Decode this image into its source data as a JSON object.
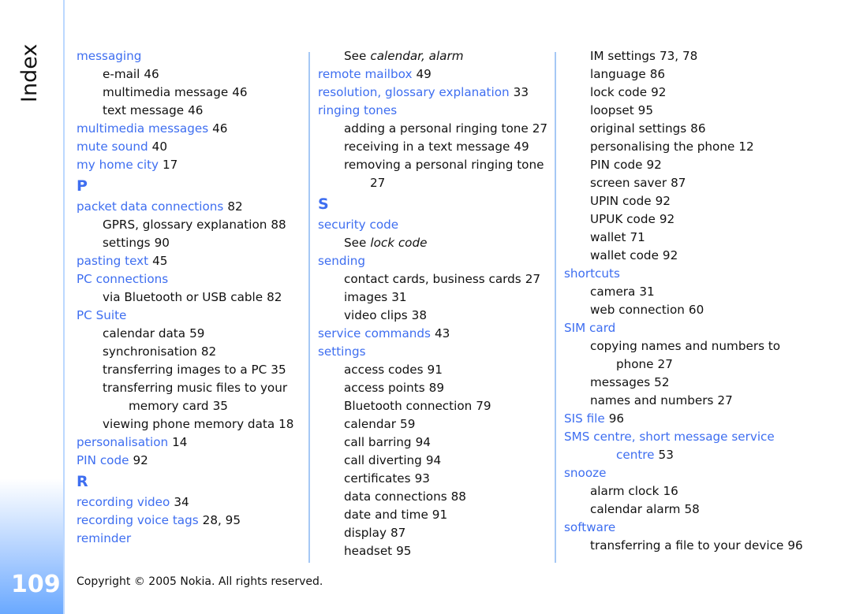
{
  "sidebar": {
    "title": "Index",
    "page_number": "109"
  },
  "footer": {
    "copyright": "Copyright © 2005 Nokia. All rights reserved."
  },
  "colors": {
    "term": "#3e6ef0",
    "rule": "#a6c8f5",
    "sidebar_gradient_bottom": "#6aa9ff"
  },
  "columns": [
    {
      "entries": [
        {
          "type": "term",
          "text": "messaging",
          "pages": ""
        },
        {
          "type": "sub",
          "text": "e-mail",
          "pages": "46"
        },
        {
          "type": "sub",
          "text": "multimedia message",
          "pages": "46"
        },
        {
          "type": "sub",
          "text": "text message",
          "pages": "46"
        },
        {
          "type": "term",
          "text": "multimedia messages",
          "pages": "46"
        },
        {
          "type": "term",
          "text": "mute sound",
          "pages": "40"
        },
        {
          "type": "term",
          "text": "my home city",
          "pages": "17"
        },
        {
          "type": "letter",
          "text": "P"
        },
        {
          "type": "term",
          "text": "packet data connections",
          "pages": "82"
        },
        {
          "type": "sub",
          "text": "GPRS, glossary explanation",
          "pages": "88"
        },
        {
          "type": "sub",
          "text": "settings",
          "pages": "90"
        },
        {
          "type": "term",
          "text": "pasting text",
          "pages": "45"
        },
        {
          "type": "term",
          "text": "PC connections",
          "pages": ""
        },
        {
          "type": "sub",
          "text": "via Bluetooth or USB cable",
          "pages": "82"
        },
        {
          "type": "term",
          "text": "PC Suite",
          "pages": ""
        },
        {
          "type": "sub",
          "text": "calendar data",
          "pages": "59"
        },
        {
          "type": "sub",
          "text": "synchronisation",
          "pages": "82"
        },
        {
          "type": "sub",
          "text": "transferring images to a PC",
          "pages": "35"
        },
        {
          "type": "sub",
          "text": "transferring music files to your",
          "pages": ""
        },
        {
          "type": "sub2",
          "text": "memory card",
          "pages": "35"
        },
        {
          "type": "sub",
          "text": "viewing phone memory data",
          "pages": "18"
        },
        {
          "type": "term",
          "text": "personalisation",
          "pages": "14"
        },
        {
          "type": "term",
          "text": "PIN code",
          "pages": "92"
        },
        {
          "type": "letter",
          "text": "R"
        },
        {
          "type": "term",
          "text": "recording video",
          "pages": "34"
        },
        {
          "type": "term",
          "text": "recording voice tags",
          "pages": "28, 95"
        },
        {
          "type": "term",
          "text": "reminder",
          "pages": ""
        }
      ]
    },
    {
      "entries": [
        {
          "type": "see",
          "text": "See",
          "ref": "calendar, alarm"
        },
        {
          "type": "term",
          "text": "remote mailbox",
          "pages": "49"
        },
        {
          "type": "term",
          "text": "resolution, glossary explanation",
          "pages": "33"
        },
        {
          "type": "term",
          "text": "ringing tones",
          "pages": ""
        },
        {
          "type": "sub",
          "text": "adding a personal ringing tone",
          "pages": "27"
        },
        {
          "type": "sub",
          "text": "receiving in a text message",
          "pages": "49"
        },
        {
          "type": "sub",
          "text": "removing a personal ringing tone",
          "pages": ""
        },
        {
          "type": "sub2",
          "text": "",
          "pages": "27"
        },
        {
          "type": "letter",
          "text": "S"
        },
        {
          "type": "term",
          "text": "security code",
          "pages": ""
        },
        {
          "type": "see",
          "text": "See",
          "ref": "lock code"
        },
        {
          "type": "term",
          "text": "sending",
          "pages": ""
        },
        {
          "type": "sub",
          "text": "contact cards, business cards",
          "pages": "27"
        },
        {
          "type": "sub",
          "text": "images",
          "pages": "31"
        },
        {
          "type": "sub",
          "text": "video clips",
          "pages": "38"
        },
        {
          "type": "term",
          "text": "service commands",
          "pages": "43"
        },
        {
          "type": "term",
          "text": "settings",
          "pages": ""
        },
        {
          "type": "sub",
          "text": "access codes",
          "pages": "91"
        },
        {
          "type": "sub",
          "text": "access points",
          "pages": "89"
        },
        {
          "type": "sub",
          "text": "Bluetooth connection",
          "pages": "79"
        },
        {
          "type": "sub",
          "text": "calendar",
          "pages": "59"
        },
        {
          "type": "sub",
          "text": "call barring",
          "pages": "94"
        },
        {
          "type": "sub",
          "text": "call diverting",
          "pages": "94"
        },
        {
          "type": "sub",
          "text": "certificates",
          "pages": "93"
        },
        {
          "type": "sub",
          "text": "data connections",
          "pages": "88"
        },
        {
          "type": "sub",
          "text": "date and time",
          "pages": "91"
        },
        {
          "type": "sub",
          "text": "display",
          "pages": "87"
        },
        {
          "type": "sub",
          "text": "headset",
          "pages": "95"
        }
      ]
    },
    {
      "entries": [
        {
          "type": "sub",
          "text": "IM settings",
          "pages": "73, 78"
        },
        {
          "type": "sub",
          "text": "language",
          "pages": "86"
        },
        {
          "type": "sub",
          "text": "lock code",
          "pages": "92"
        },
        {
          "type": "sub",
          "text": "loopset",
          "pages": "95"
        },
        {
          "type": "sub",
          "text": "original settings",
          "pages": "86"
        },
        {
          "type": "sub",
          "text": "personalising the phone",
          "pages": "12"
        },
        {
          "type": "sub",
          "text": "PIN code",
          "pages": "92"
        },
        {
          "type": "sub",
          "text": "screen saver",
          "pages": "87"
        },
        {
          "type": "sub",
          "text": "UPIN code",
          "pages": "92"
        },
        {
          "type": "sub",
          "text": "UPUK code",
          "pages": "92"
        },
        {
          "type": "sub",
          "text": "wallet",
          "pages": "71"
        },
        {
          "type": "sub",
          "text": "wallet code",
          "pages": "92"
        },
        {
          "type": "term",
          "text": "shortcuts",
          "pages": ""
        },
        {
          "type": "sub",
          "text": "camera",
          "pages": "31"
        },
        {
          "type": "sub",
          "text": "web connection",
          "pages": "60"
        },
        {
          "type": "term",
          "text": "SIM card",
          "pages": ""
        },
        {
          "type": "sub",
          "text": "copying names and numbers to",
          "pages": ""
        },
        {
          "type": "sub2",
          "text": "phone",
          "pages": "27"
        },
        {
          "type": "sub",
          "text": "messages",
          "pages": "52"
        },
        {
          "type": "sub",
          "text": "names and numbers",
          "pages": "27"
        },
        {
          "type": "term",
          "text": "SIS file",
          "pages": "96"
        },
        {
          "type": "term",
          "text": "SMS centre, short message service",
          "pages": ""
        },
        {
          "type": "cont-term",
          "text": "centre",
          "pages": "53"
        },
        {
          "type": "term",
          "text": "snooze",
          "pages": ""
        },
        {
          "type": "sub",
          "text": "alarm clock",
          "pages": "16"
        },
        {
          "type": "sub",
          "text": "calendar alarm",
          "pages": "58"
        },
        {
          "type": "term",
          "text": "software",
          "pages": ""
        },
        {
          "type": "sub",
          "text": "transferring a file to your device",
          "pages": "96"
        }
      ]
    }
  ]
}
